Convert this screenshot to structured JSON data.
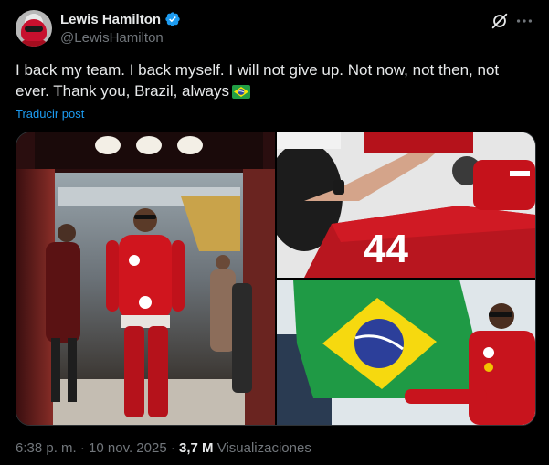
{
  "author": {
    "display_name": "Lewis Hamilton",
    "handle": "@LewisHamilton",
    "verified": true,
    "verified_color": "#1d9bf0"
  },
  "tweet": {
    "text": "I back my team. I back myself. I will not give up. Not now, not then, not ever. Thank you, Brazil, always",
    "emoji": "flag-brazil",
    "translate_label": "Traducir post"
  },
  "media": [
    {
      "name": "photo-hamilton-walking",
      "tile": "left"
    },
    {
      "name": "photo-car-44",
      "tile": "top-right"
    },
    {
      "name": "photo-brazil-flag",
      "tile": "bottom-right"
    }
  ],
  "meta": {
    "time": "6:38 p. m.",
    "separator": "·",
    "date": "10 nov. 2025",
    "separator2": "·",
    "views_count": "3,7 M",
    "views_label": "Visualizaciones"
  },
  "icons": {
    "grok": "grok-icon",
    "more": "more-icon"
  },
  "colors": {
    "background": "#000000",
    "text": "#e7e9ea",
    "secondary": "#71767b",
    "link": "#1d9bf0",
    "ferrari_red": "#c8102e"
  }
}
